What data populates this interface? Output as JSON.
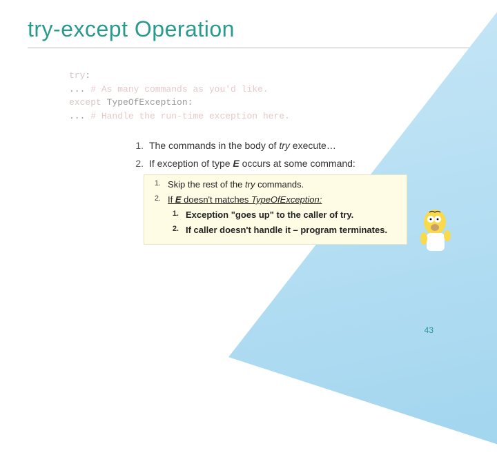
{
  "title": "try-except Operation",
  "code": {
    "line1_kw": "try",
    "line1_colon": ":",
    "line2_indent": "  ... ",
    "line2_cmt": "# As many commands as you'd like.",
    "line3_kw": "except",
    "line3_rest": " TypeOfException:",
    "line4_indent": "  ... ",
    "line4_cmt": "# Handle the run-time exception here."
  },
  "list": {
    "n1": "1.",
    "t1_a": "The commands in the body of ",
    "t1_b": "try",
    "t1_c": " execute…",
    "n2": "2.",
    "t2_a": "If exception of type ",
    "t2_b": "E",
    "t2_c": " occurs at some command:"
  },
  "sub": {
    "n1": "1.",
    "t1_a": "Skip the rest of the ",
    "t1_b": "try",
    "t1_c": " commands.",
    "n2": "2.",
    "t2_a": "If ",
    "t2_b": "E",
    "t2_c": " doesn't matches ",
    "t2_d": "TypeOfException:",
    "ss_n1": "1.",
    "ss_t1": "Exception \"goes up\" to the caller of try.",
    "ss_n2": "2.",
    "ss_t2": "If caller doesn't handle it – program terminates."
  },
  "page_number": "43"
}
